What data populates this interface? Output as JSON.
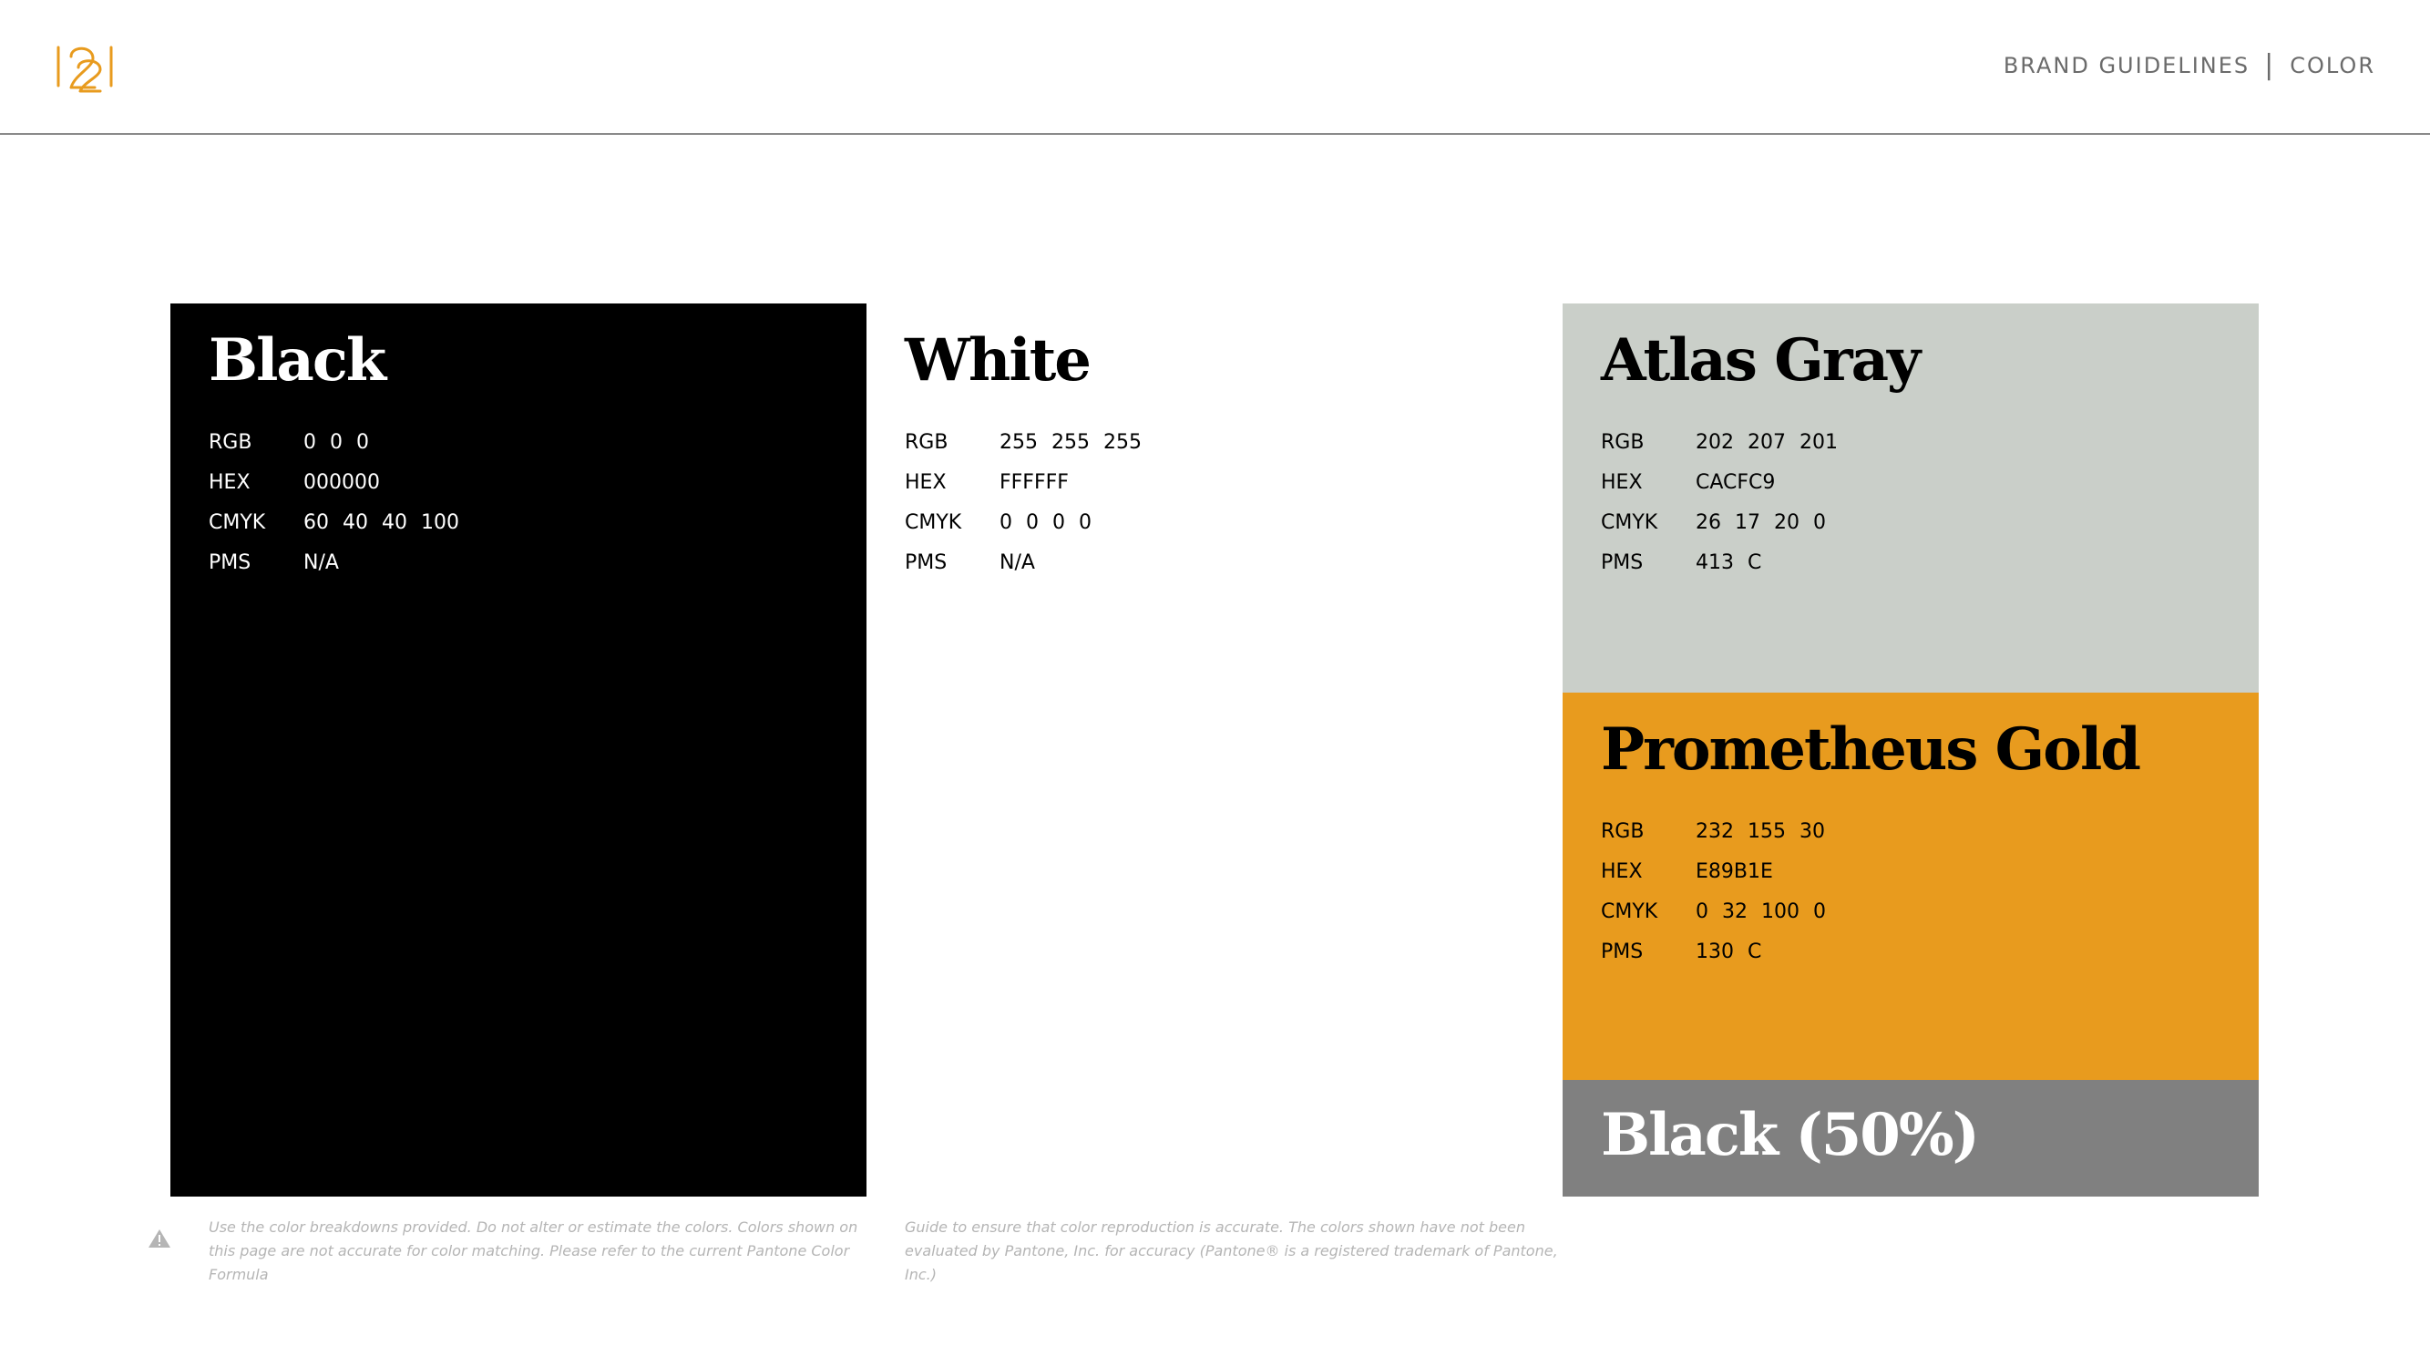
{
  "header": {
    "logo_alt": "1221",
    "nav_section": "BRAND GUIDELINES",
    "nav_separator": "|",
    "nav_page": "COLOR"
  },
  "colors": {
    "black": {
      "name": "Black",
      "swatch": "#000000",
      "specs": [
        {
          "label": "RGB",
          "value": "0 0 0"
        },
        {
          "label": "HEX",
          "value": "000000"
        },
        {
          "label": "CMYK",
          "value": "60 40 40 100"
        },
        {
          "label": "PMS",
          "value": "N/A"
        }
      ]
    },
    "white": {
      "name": "White",
      "swatch": "#FFFFFF",
      "specs": [
        {
          "label": "RGB",
          "value": "255 255 255"
        },
        {
          "label": "HEX",
          "value": "FFFFFF"
        },
        {
          "label": "CMYK",
          "value": "0 0 0 0"
        },
        {
          "label": "PMS",
          "value": "N/A"
        }
      ]
    },
    "atlas_gray": {
      "name": "Atlas Gray",
      "swatch": "#CACFC9",
      "specs": [
        {
          "label": "RGB",
          "value": "202 207 201"
        },
        {
          "label": "HEX",
          "value": "CACFC9"
        },
        {
          "label": "CMYK",
          "value": "26 17 20 0"
        },
        {
          "label": "PMS",
          "value": "413 C"
        }
      ]
    },
    "prometheus_gold": {
      "name": "Prometheus Gold",
      "swatch": "#E89B1E",
      "specs": [
        {
          "label": "RGB",
          "value": "232 155 30"
        },
        {
          "label": "HEX",
          "value": "E89B1E"
        },
        {
          "label": "CMYK",
          "value": "0 32 100 0"
        },
        {
          "label": "PMS",
          "value": "130 C"
        }
      ]
    },
    "black_50": {
      "name": "Black (50%)",
      "swatch": "#808080"
    }
  },
  "disclaimer": {
    "icon": "warning-icon",
    "col1": "Use the color breakdowns provided. Do not alter or estimate the colors. Colors shown on this page are not accurate for color matching. Please refer to the current Pantone Color Formula",
    "col2": "Guide to ensure that color reproduction is accurate. The colors shown have not been evaluated by Pantone, Inc. for accuracy (Pantone® is a registered trademark of Pantone, Inc.)"
  }
}
